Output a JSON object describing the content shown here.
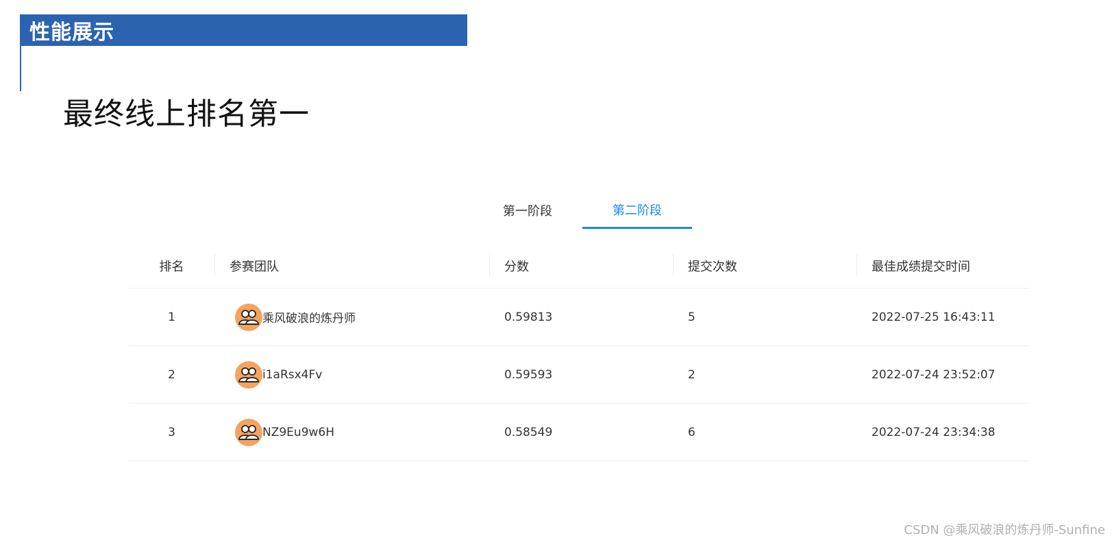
{
  "header": {
    "section_title": "性能展示",
    "slide_title": "最终线上排名第一"
  },
  "tabs": [
    {
      "label": "第一阶段",
      "active": false
    },
    {
      "label": "第二阶段",
      "active": true
    }
  ],
  "leaderboard": {
    "columns": [
      "排名",
      "参赛团队",
      "分数",
      "提交次数",
      "最佳成绩提交时间"
    ],
    "rows": [
      {
        "rank": "1",
        "team": "乘风破浪的炼丹师",
        "score": "0.59813",
        "submissions": "5",
        "best_time": "2022-07-25 16:43:11"
      },
      {
        "rank": "2",
        "team": "i1aRsx4Fv",
        "score": "0.59593",
        "submissions": "2",
        "best_time": "2022-07-24 23:52:07"
      },
      {
        "rank": "3",
        "team": "NZ9Eu9w6H",
        "score": "0.58549",
        "submissions": "6",
        "best_time": "2022-07-24 23:34:38"
      }
    ]
  },
  "watermark": "CSDN @乘风破浪的炼丹师-Sunfine",
  "colors": {
    "brand_blue": "#2b63b1",
    "tab_active": "#1a88ee",
    "avatar_bg": "#f5a35e"
  },
  "icons": {
    "avatar": "team-icon"
  }
}
